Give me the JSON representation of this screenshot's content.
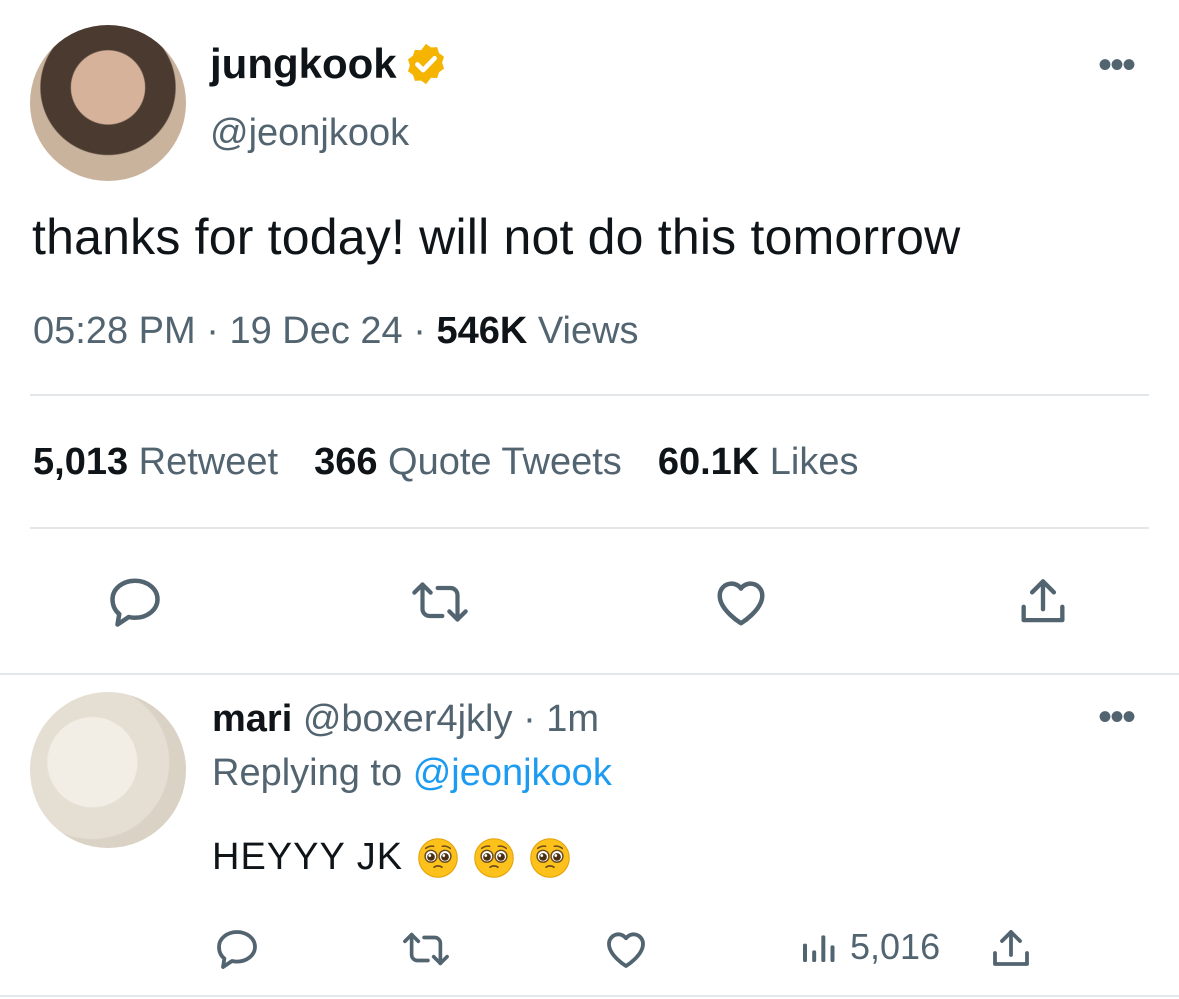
{
  "tweet": {
    "display_name": "jungkook",
    "handle": "@jeonjkook",
    "text": "thanks for today! will not do this tomorrow",
    "time": "05:28 PM",
    "date": "19 Dec 24",
    "views_count": "546K",
    "views_label": "Views",
    "retweets_count": "5,013",
    "retweets_label": "Retweet",
    "quotes_count": "366",
    "quotes_label": "Quote Tweets",
    "likes_count": "60.1K",
    "likes_label": "Likes",
    "separator": "·",
    "more_glyph": "•••"
  },
  "reply": {
    "display_name": "mari",
    "handle": "@boxer4jkly",
    "time": "1m",
    "separator": "·",
    "replying_prefix": "Replying to",
    "replying_handle": "@jeonjkook",
    "text": "HEYYY JK",
    "emoji_count": 3,
    "views_count": "5,016",
    "more_glyph": "•••"
  },
  "colors": {
    "text": "#0f1419",
    "muted": "#536471",
    "link": "#1d9bf0",
    "verified": "#f4b400",
    "divider": "#e3e7ea"
  },
  "icons": [
    "verified-badge-icon",
    "reply-icon",
    "retweet-icon",
    "like-icon",
    "share-icon",
    "views-icon",
    "more-icon",
    "pleading-face-emoji"
  ]
}
